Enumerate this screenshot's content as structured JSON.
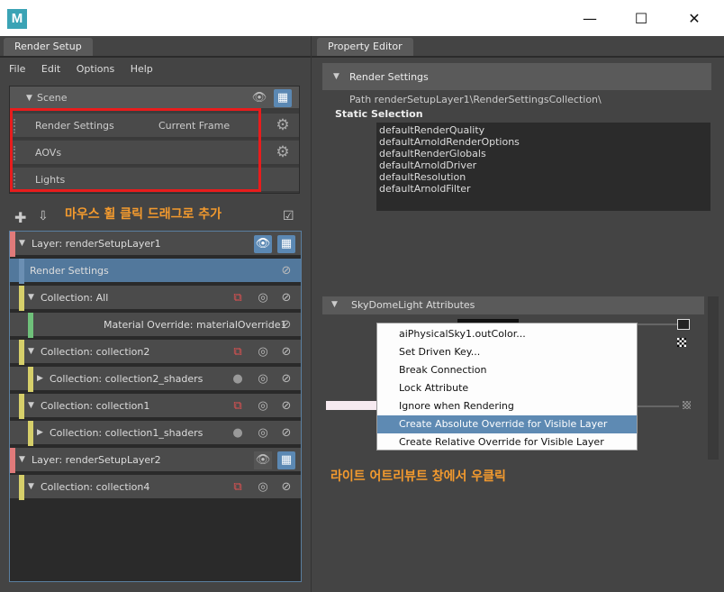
{
  "window": {
    "icon_letter": "M",
    "min": "—",
    "max": "☐",
    "close": "✕"
  },
  "left": {
    "tab": "Render Setup",
    "menu": [
      "File",
      "Edit",
      "Options",
      "Help"
    ],
    "scene": {
      "label": "Scene",
      "rows": [
        {
          "label": "Render Settings",
          "extra": "Current Frame"
        },
        {
          "label": "AOVs",
          "extra": ""
        },
        {
          "label": "Lights",
          "extra": ""
        }
      ]
    },
    "annotation": "마우스 휠 클릭 드래그로 추가",
    "tree": [
      {
        "label": "Layer:  renderSetupLayer1",
        "indent": 0,
        "color": "#e07a7a"
      },
      {
        "label": "Render Settings",
        "indent": 1,
        "selected": true
      },
      {
        "label": "Collection:  All",
        "indent": 1,
        "color": "#d6cf6a"
      },
      {
        "label": "Material Override:  materialOverride1",
        "indent": 2,
        "color": "#6fc07a"
      },
      {
        "label": "Collection:  collection2",
        "indent": 1,
        "color": "#d6cf6a"
      },
      {
        "label": "Collection:  collection2_shaders",
        "indent": 2,
        "color": "#d6cf6a"
      },
      {
        "label": "Collection:  collection1",
        "indent": 1,
        "color": "#d6cf6a"
      },
      {
        "label": "Collection:  collection1_shaders",
        "indent": 2,
        "color": "#d6cf6a"
      },
      {
        "label": "Layer:  renderSetupLayer2",
        "indent": 0,
        "color": "#e07a7a"
      },
      {
        "label": "Collection:  collection4",
        "indent": 1,
        "color": "#d6cf6a"
      }
    ]
  },
  "right": {
    "tab": "Property Editor",
    "header": "Render Settings",
    "path": "Path  renderSetupLayer1\\RenderSettingsCollection\\",
    "static_label": "Static Selection",
    "static_list": [
      "defaultRenderQuality",
      "defaultArnoldRenderOptions",
      "defaultRenderGlobals",
      "defaultArnoldDriver",
      "defaultResolution",
      "defaultArnoldFilter"
    ],
    "skydome": "SkyDomeLight Attributes",
    "annotation": "라이트 어트리뷰트 창에서 우클릭",
    "context_menu": [
      "aiPhysicalSky1.outColor...",
      "Set Driven Key...",
      "Break Connection",
      "Lock Attribute",
      "Ignore when Rendering",
      "Create Absolute Override for Visible Layer",
      "Create Relative Override for Visible Layer"
    ]
  }
}
